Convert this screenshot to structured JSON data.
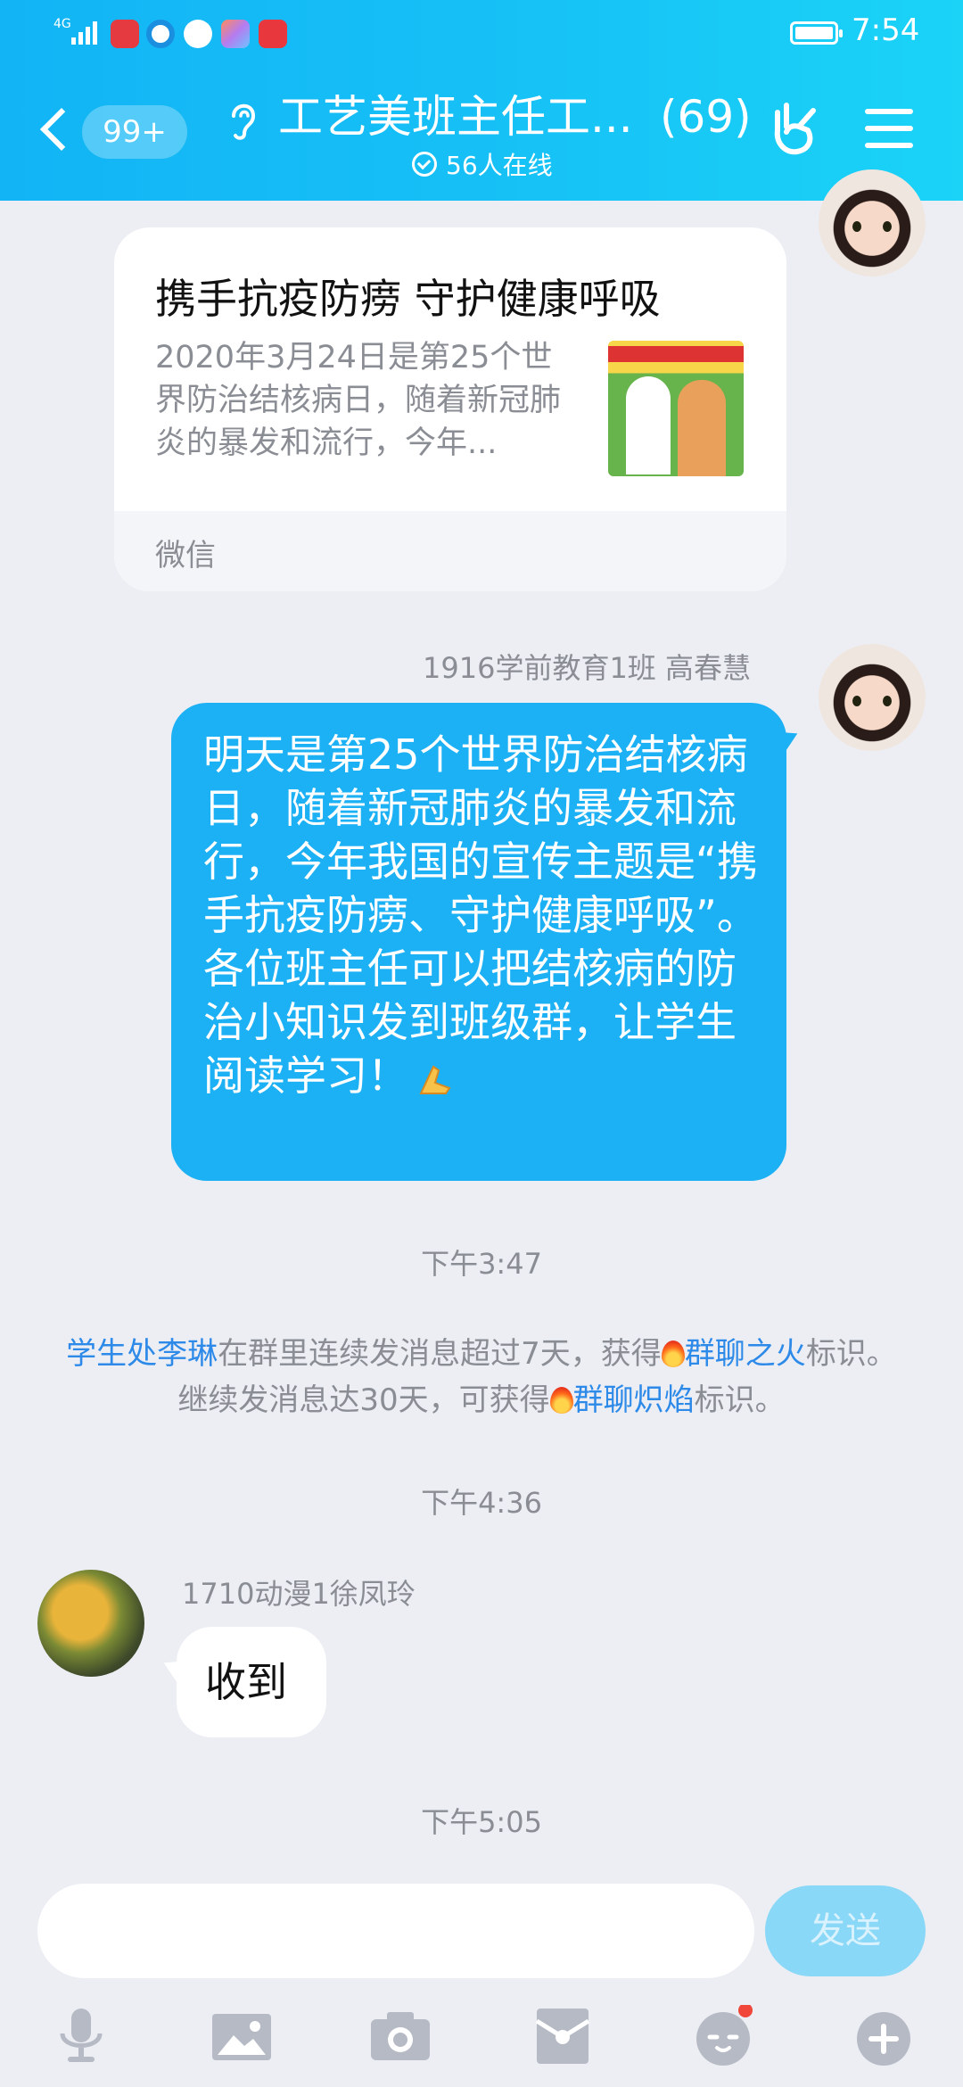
{
  "status_bar": {
    "network": "4G",
    "time": "7:54"
  },
  "header": {
    "unread_badge": "99+",
    "title": "工艺美班主任工...",
    "member_count": "(69)",
    "online": "56人在线"
  },
  "messages": {
    "share_card": {
      "title": "携手抗疫防痨 守护健康呼吸",
      "description": "2020年3月24日是第25个世界防治结核病日，随着新冠肺炎的暴发和流行，今年...",
      "source": "微信"
    },
    "blue_msg": {
      "sender": "1916学前教育1班 高春慧",
      "text": "明天是第25个世界防治结核病日，随着新冠肺炎的暴发和流行，今年我国的宣传主题是“携手抗疫防痨、守护健康呼吸”。各位班主任可以把结核病的防治小知识发到班级群，让学生阅读学习！"
    },
    "time1": "下午3:47",
    "system": {
      "user": "学生处李琳",
      "text1": "在群里连续发消息超过7天，获得",
      "badge1": "群聊之火",
      "text2": "标识。继续发消息达30天，可获得",
      "badge2": "群聊炽焰",
      "text3": "标识。"
    },
    "time2": "下午4:36",
    "white_msg": {
      "sender": "1710动漫1徐凤玲",
      "text": "收到"
    },
    "time3": "下午5:05"
  },
  "input": {
    "placeholder": "",
    "send_label": "发送"
  },
  "toolbar": {
    "icons": [
      "microphone-icon",
      "image-icon",
      "camera-icon",
      "red-packet-icon",
      "emoji-icon",
      "plus-icon"
    ]
  },
  "colors": {
    "header_start": "#12b4f5",
    "header_end": "#1ad3f7",
    "bubble_blue": "#1cb0f4",
    "link": "#2d8ae8",
    "send_disabled": "#8ad8f7",
    "notification_dot": "#f0473a"
  }
}
